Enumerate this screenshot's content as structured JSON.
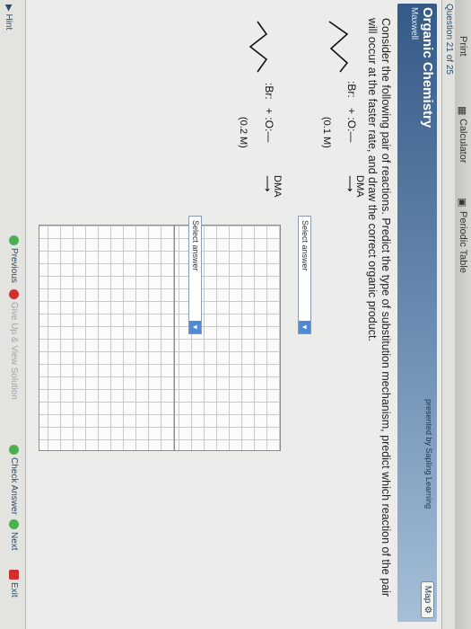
{
  "toolbar": {
    "items": [
      "Print",
      "Calculator",
      "Periodic Table"
    ]
  },
  "question_bar": {
    "label": "Question 21 of 25"
  },
  "subject": {
    "title": "Organic Chemistry",
    "subtitle": "Maxwell",
    "brand": "presented by Sapling Learning",
    "map_label": "Map"
  },
  "question": {
    "text": "Consider the following pair of reactions. Predict the type of substitution mechanism, predict which reaction of the pair will occur at the faster rate, and draw the correct organic product."
  },
  "reaction1": {
    "reagent": "+  :O:—",
    "conditions": "DMA",
    "concentration": "(0.1 M)",
    "select_label": "Select answer"
  },
  "reaction2": {
    "reagent": "+  :O:—",
    "conditions": "DMA",
    "concentration": "(0.2 M)",
    "select_label": "Select answer"
  },
  "footer": {
    "hint": "Hint",
    "previous": "Previous",
    "give_up": "Give Up & View Solution",
    "check": "Check Answer",
    "next": "Next",
    "exit": "Exit"
  },
  "colors": {
    "header_start": "#355a86",
    "header_end": "#a6bfd8",
    "select_button": "#4f8ad8"
  }
}
